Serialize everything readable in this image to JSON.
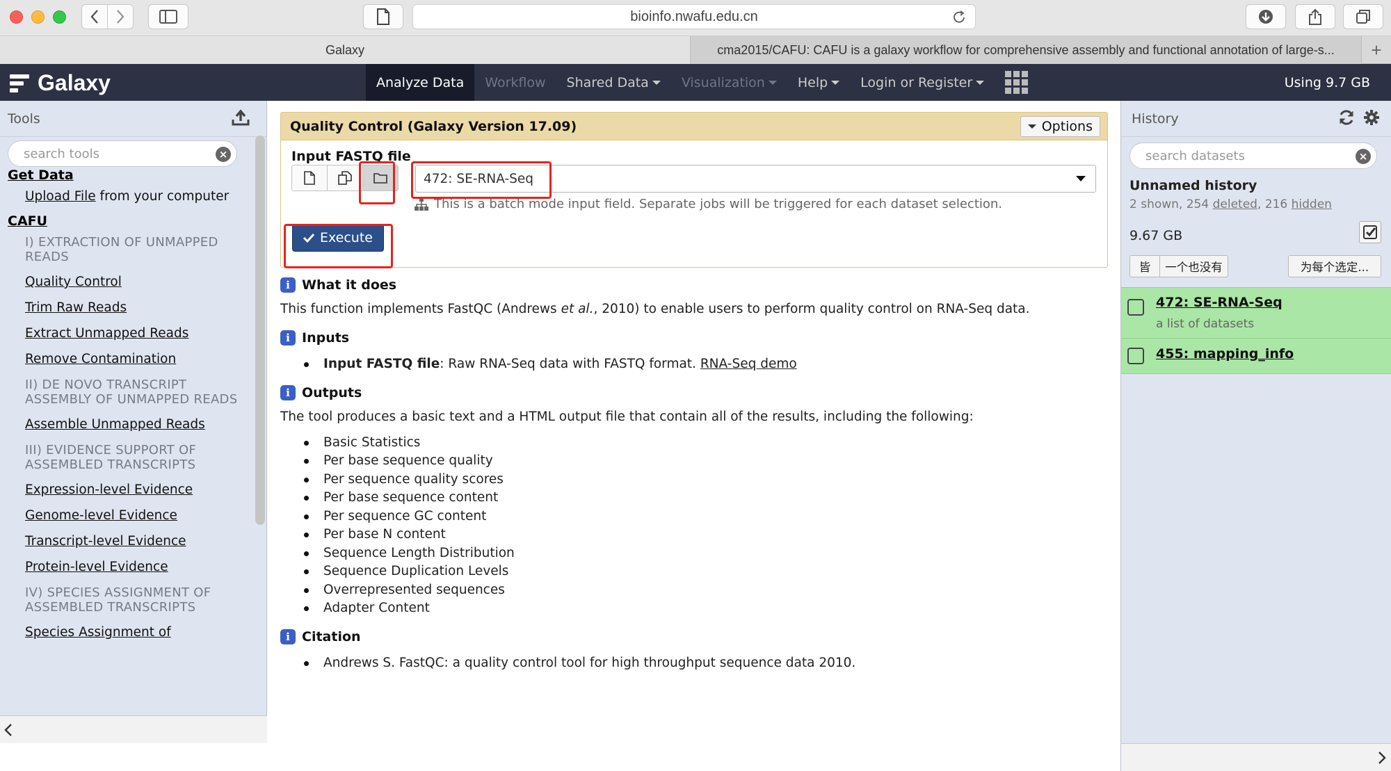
{
  "browser": {
    "url": "bioinfo.nwafu.edu.cn",
    "tabs": [
      {
        "label": "Galaxy"
      },
      {
        "label": "cma2015/CAFU: CAFU is a galaxy workflow for comprehensive assembly and functional annotation of large-s..."
      }
    ],
    "new_tab_label": "+"
  },
  "masthead": {
    "brand": "Galaxy",
    "nav": [
      {
        "label": "Analyze Data"
      },
      {
        "label": "Workflow"
      },
      {
        "label": "Shared Data"
      },
      {
        "label": "Visualization"
      },
      {
        "label": "Help"
      },
      {
        "label": "Login or Register"
      }
    ],
    "quota": "Using 9.7 GB"
  },
  "tools_panel": {
    "title": "Tools",
    "search_placeholder": "search tools",
    "get_data": {
      "heading": "Get Data",
      "upload_link": "Upload File",
      "upload_suffix": " from your computer"
    },
    "cafu_heading": "CAFU",
    "items": [
      {
        "label": "I) EXTRACTION OF UNMAPPED READS"
      },
      {
        "label": "Quality Control"
      },
      {
        "label": "Trim Raw Reads"
      },
      {
        "label": "Extract Unmapped Reads"
      },
      {
        "label": "Remove Contamination"
      },
      {
        "label": "II) DE NOVO TRANSCRIPT ASSEMBLY OF UNMAPPED READS"
      },
      {
        "label": "Assemble Unmapped Reads"
      },
      {
        "label": "III) EVIDENCE SUPPORT OF ASSEMBLED TRANSCRIPTS"
      },
      {
        "label": "Expression-level Evidence"
      },
      {
        "label": "Genome-level Evidence"
      },
      {
        "label": "Transcript-level Evidence"
      },
      {
        "label": "Protein-level Evidence"
      },
      {
        "label": "IV) SPECIES ASSIGNMENT OF ASSEMBLED TRANSCRIPTS"
      },
      {
        "label": "Species Assignment of"
      }
    ]
  },
  "tool_form": {
    "title": "Quality Control (Galaxy Version 17.09)",
    "options_label": "Options",
    "input_label": "Input FASTQ file",
    "selected_dataset": "472: SE-RNA-Seq",
    "batch_note": "This is a batch mode input field. Separate jobs will be triggered for each dataset selection.",
    "execute_label": "Execute"
  },
  "help": {
    "what_heading": "What it does",
    "what_text_1": "This function implements FastQC (Andrews ",
    "what_text_em": "et al.",
    "what_text_2": ", 2010) to enable users to perform quality control on RNA-Seq data.",
    "inputs_heading": "Inputs",
    "input_item_bold": "Input FASTQ file",
    "input_item_text": ": Raw RNA-Seq data with FASTQ format. ",
    "input_item_link": "RNA-Seq demo",
    "outputs_heading": "Outputs",
    "outputs_text": "The tool produces a basic text and a HTML output file that contain all of the results, including the following:",
    "outputs": [
      "Basic Statistics",
      "Per base sequence quality",
      "Per sequence quality scores",
      "Per base sequence content",
      "Per sequence GC content",
      "Per base N content",
      "Sequence Length Distribution",
      "Sequence Duplication Levels",
      "Overrepresented sequences",
      "Adapter Content"
    ],
    "citation_heading": "Citation",
    "citation": "Andrews S. FastQC: a quality control tool for high throughput sequence data 2010."
  },
  "history_panel": {
    "title": "History",
    "search_placeholder": "search datasets",
    "name": "Unnamed history",
    "stats_prefix": "2 shown, 254 ",
    "stats_deleted": "deleted",
    "stats_sep": ", 216 ",
    "stats_hidden": "hidden",
    "size": "9.67 GB",
    "btn_all": "皆",
    "btn_none": "一个也没有",
    "btn_for_each": "为每个选定...",
    "datasets": [
      {
        "title": "472: SE-RNA-Seq",
        "subtitle": "a list of datasets"
      },
      {
        "title": "455: mapping_info"
      }
    ]
  },
  "colors": {
    "masthead_bg": "#2c3143",
    "panel_bg": "#dfe5f0",
    "form_header_bg": "#ebd9a7",
    "execute_bg": "#2c4f8a",
    "dataset_ok_bg": "#aae6a6",
    "highlight": "#e8231b"
  },
  "icons": [
    "back-icon",
    "forward-icon",
    "sidebar-icon",
    "page-icon",
    "reload-icon",
    "download-icon",
    "share-icon",
    "tabs-icon",
    "upload-icon",
    "refresh-icon",
    "gear-icon",
    "clear-icon",
    "file-icon",
    "copy-icon",
    "folder-icon",
    "sitemap-icon",
    "check-icon",
    "info-icon",
    "apps-grid-icon"
  ]
}
